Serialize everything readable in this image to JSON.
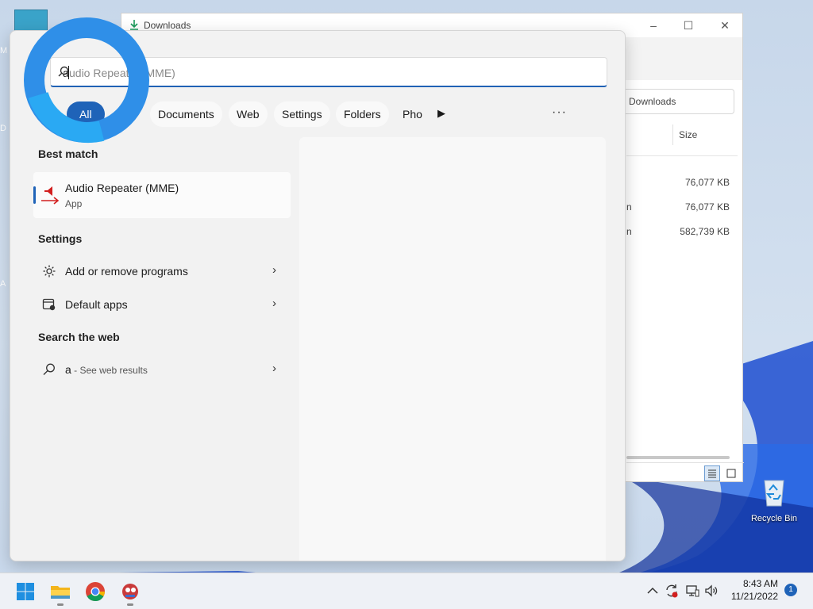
{
  "explorer": {
    "title": "Downloads",
    "search_placeholder": "rch Downloads",
    "column_size": "Size",
    "rows": [
      {
        "name_fragment": "",
        "size": "76,077 KB"
      },
      {
        "name_fragment": "n",
        "size": "76,077 KB"
      },
      {
        "name_fragment": "n",
        "size": "582,739 KB"
      }
    ]
  },
  "search": {
    "typed": "a",
    "suggestion": "udio Repeater (MME)"
  },
  "filters": {
    "items": [
      "All",
      "Documents",
      "Web",
      "Settings",
      "Folders",
      "Pho"
    ]
  },
  "sections": {
    "best_match": "Best match",
    "settings": "Settings",
    "web": "Search the web"
  },
  "best_match": {
    "name": "Audio Repeater (MME)",
    "type": "App"
  },
  "settings_items": [
    {
      "label": "Add or remove programs",
      "icon": "gear-icon"
    },
    {
      "label": "Default apps",
      "icon": "default-apps-icon"
    }
  ],
  "web_result": {
    "query": "a",
    "hint": " - See web results"
  },
  "desktop": {
    "recycle_bin": "Recycle Bin",
    "left_edge_letters": [
      "M",
      "D",
      "A"
    ]
  },
  "taskbar": {
    "time": "8:43 AM",
    "date": "11/21/2022",
    "notification_count": "1"
  },
  "colors": {
    "accent": "#1f63b8",
    "loading_ring": "#2196f3"
  }
}
